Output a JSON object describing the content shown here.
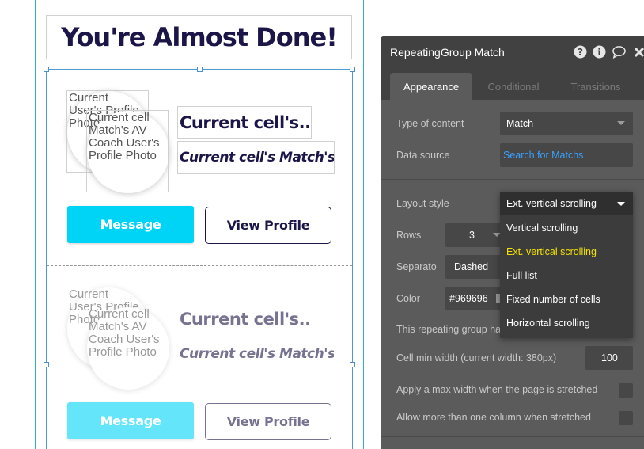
{
  "canvas": {
    "title": "You're Almost Done!",
    "cells": [
      {
        "photo_lines_a": [
          "Current",
          "User's Profile",
          "Photo"
        ],
        "photo_lines_b": [
          "Current cell",
          "Match's AV",
          "Coach User's",
          "Profile Photo"
        ],
        "main_text": "Current cell's...",
        "sub_text": "Current cell's Match's...",
        "message_label": "Message",
        "view_label": "View Profile"
      },
      {
        "photo_lines_a": [
          "Current",
          "User's Profile",
          "Photo"
        ],
        "photo_lines_b": [
          "Current cell",
          "Match's AV",
          "Coach User's",
          "Profile Photo"
        ],
        "main_text": "Current cell's...",
        "sub_text": "Current cell's Match's...",
        "message_label": "Message",
        "view_label": "View Profile"
      }
    ]
  },
  "panel": {
    "title": "RepeatingGroup Match",
    "icons": [
      "help-icon",
      "info-icon",
      "comment-icon",
      "close-icon"
    ],
    "tabs": [
      {
        "label": "Appearance",
        "active": true
      },
      {
        "label": "Conditional",
        "active": false
      },
      {
        "label": "Transitions",
        "active": false
      }
    ],
    "type_of_content": {
      "label": "Type of content",
      "value": "Match"
    },
    "data_source": {
      "label": "Data source",
      "value": "Search for Matchs"
    },
    "layout_style": {
      "label": "Layout style",
      "value": "Ext. vertical scrolling",
      "options": [
        "Vertical scrolling",
        "Ext. vertical scrolling",
        "Full list",
        "Fixed number of cells",
        "Horizontal scrolling"
      ],
      "selected_index": 1
    },
    "rows": {
      "label": "Rows",
      "value": "3"
    },
    "separator": {
      "label": "Separato",
      "value": "Dashed"
    },
    "color": {
      "label": "Color",
      "value": "#969696"
    },
    "has_header": {
      "label": "This repeating group ha"
    },
    "cell_min_width": {
      "label": "Cell min width (current width: 380px)",
      "value": "100"
    },
    "max_width": {
      "label": "Apply a max width when the page is stretched"
    },
    "more_columns": {
      "label": "Allow more than one column when stretched"
    }
  },
  "colors": {
    "accent_cyan": "#00d4f6",
    "title_navy": "#1c1548",
    "panel_bg": "#5b5b5b",
    "selected_yellow": "#f2e100",
    "link_blue": "#3aa0ff"
  }
}
